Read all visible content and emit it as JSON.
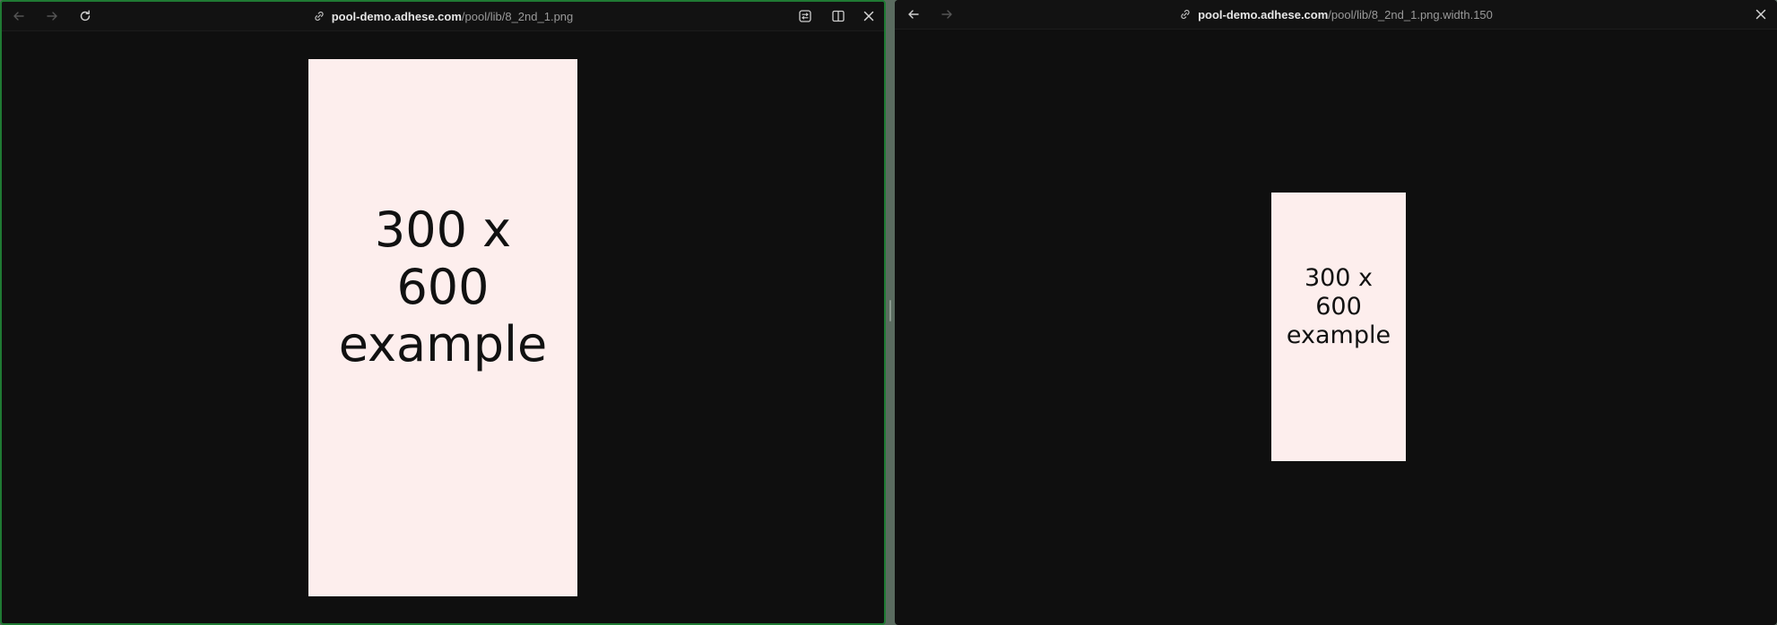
{
  "colors": {
    "window_background": "#0f0f0f",
    "active_border": "#1f7a33",
    "image_fill": "#fdeeed",
    "url_host": "#e6e6e6",
    "url_path": "#9a9a9a"
  },
  "left_pane": {
    "address": {
      "icon": "link-icon",
      "host": "pool-demo.adhese.com",
      "path": "/pool/lib/8_2nd_1.png"
    },
    "nav": {
      "back_icon": "arrow-left-icon",
      "forward_icon": "arrow-right-icon",
      "reload_icon": "reload-icon"
    },
    "actions": {
      "reader_icon": "reader-mode-icon",
      "split_icon": "split-view-icon",
      "close_icon": "close-icon"
    },
    "image": {
      "label": "300 x\n600\nexample"
    }
  },
  "right_pane": {
    "address": {
      "icon": "link-icon",
      "host": "pool-demo.adhese.com",
      "path": "/pool/lib/8_2nd_1.png.width.150"
    },
    "nav": {
      "back_icon": "arrow-left-icon",
      "forward_icon": "arrow-right-icon"
    },
    "actions": {
      "close_icon": "close-icon"
    },
    "image": {
      "label": "300 x\n600\nexample"
    }
  }
}
